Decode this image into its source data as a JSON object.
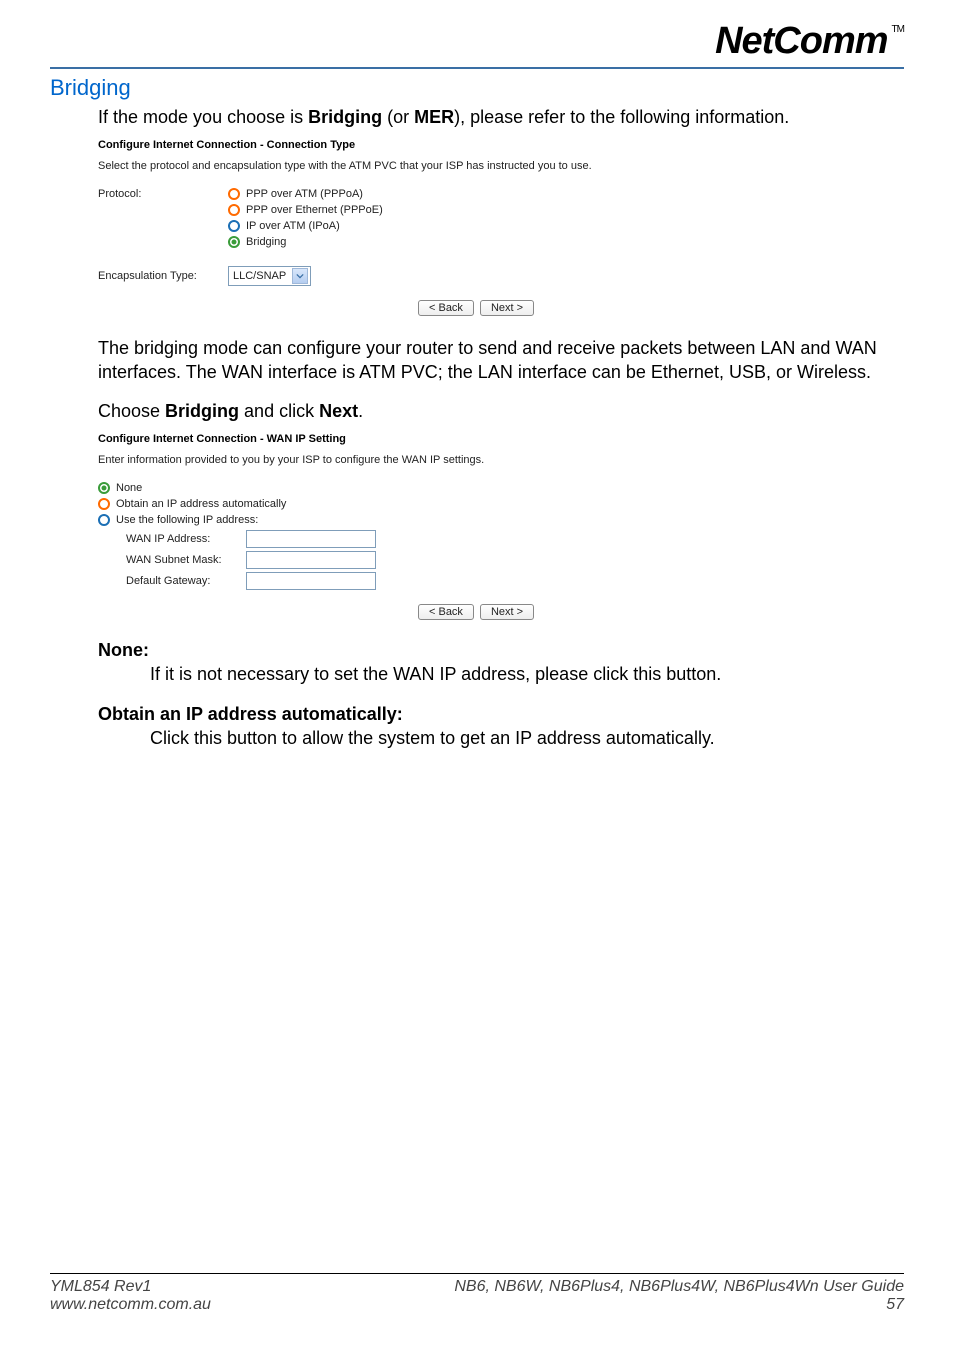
{
  "brand": {
    "name": "NetComm",
    "tm": "TM"
  },
  "section_title": "Bridging",
  "intro": {
    "pre": "If the mode you choose is ",
    "b1": "Bridging",
    "mid": " (or ",
    "b2": "MER",
    "post": "), please refer to the following information."
  },
  "shot1": {
    "title": "Configure Internet Connection - Connection Type",
    "desc": "Select the protocol and encapsulation type with the ATM PVC that your ISP has instructed you to use.",
    "protocol_label": "Protocol:",
    "options": {
      "opt1": "PPP over ATM (PPPoA)",
      "opt2": "PPP over Ethernet (PPPoE)",
      "opt3": "IP over ATM (IPoA)",
      "opt4": "Bridging"
    },
    "encap_label": "Encapsulation Type:",
    "encap_value": "LLC/SNAP",
    "back": "< Back",
    "next": "Next >"
  },
  "para2": "The bridging mode can configure your router to send and receive packets between LAN and WAN interfaces. The WAN interface is ATM PVC; the LAN interface can be Ethernet, USB, or Wireless.",
  "para3": {
    "pre": "Choose ",
    "b1": "Bridging",
    "mid": " and click ",
    "b2": "Next",
    "post": "."
  },
  "shot2": {
    "title": "Configure Internet Connection - WAN IP Setting",
    "desc": "Enter information provided to you by your ISP to configure the WAN IP settings.",
    "opt_none": "None",
    "opt_auto": "Obtain an IP address automatically",
    "opt_manual": "Use the following IP address:",
    "f_wanip": "WAN IP Address:",
    "f_mask": "WAN Subnet Mask:",
    "f_gw": "Default Gateway:",
    "back": "< Back",
    "next": "Next >"
  },
  "defs": {
    "none_t": "None:",
    "none_d": "If it is not necessary to set the WAN IP address, please click this button.",
    "auto_t": "Obtain an IP address automatically:",
    "auto_d": "Click this button to allow the system to get an IP address automatically."
  },
  "footer": {
    "rev": "YML854 Rev1",
    "url": "www.netcomm.com.au",
    "guide_models": "NB6, NB6W, NB6Plus4, NB6Plus4W, NB6Plus4Wn ",
    "guide_suffix": "User Guide",
    "page": "57"
  }
}
